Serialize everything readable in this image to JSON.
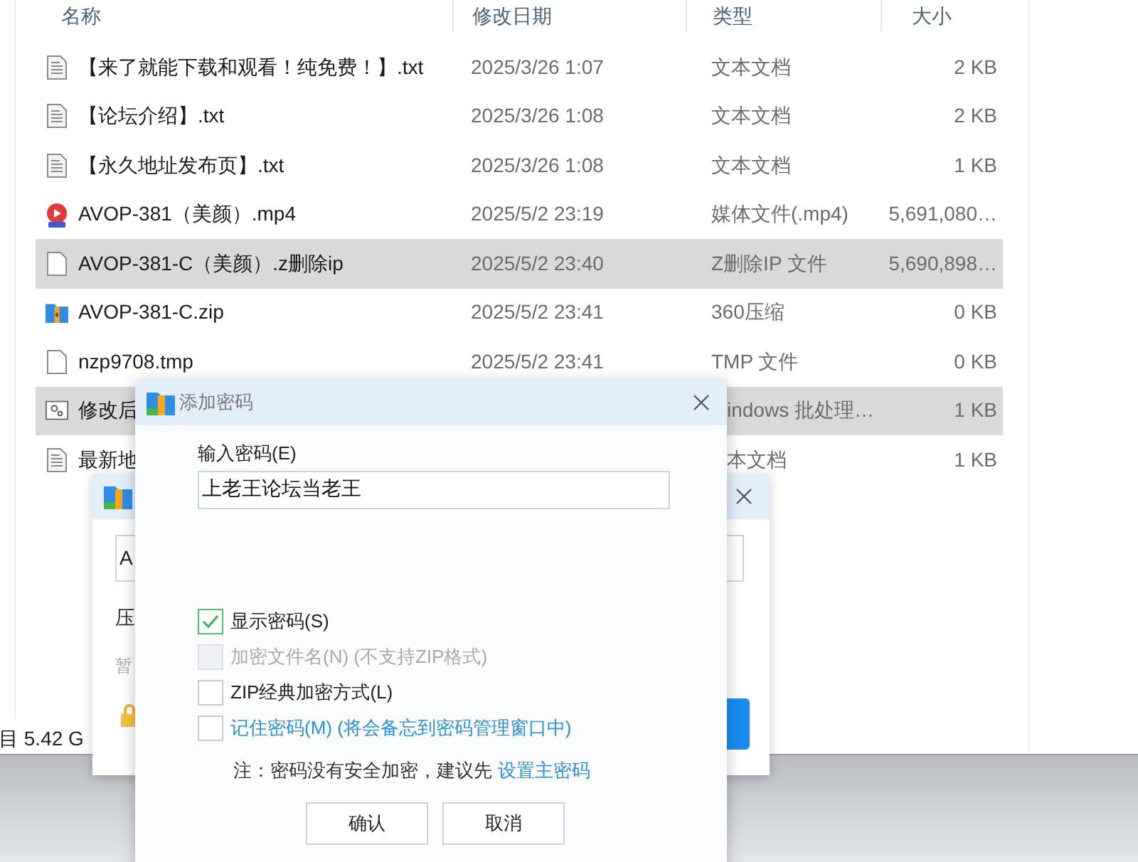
{
  "file_list": {
    "columns": [
      "名称",
      "修改日期",
      "类型",
      "大小"
    ],
    "rows": [
      {
        "kind": "text-document",
        "name": "【来了就能下载和观看！纯免费！】.txt",
        "modified": "2025/3/26 1:07",
        "type": "文本文档",
        "size": "2 KB",
        "selected": false
      },
      {
        "kind": "text-document",
        "name": "【论坛介绍】.txt",
        "modified": "2025/3/26 1:08",
        "type": "文本文档",
        "size": "2 KB",
        "selected": false
      },
      {
        "kind": "text-document",
        "name": "【永久地址发布页】.txt",
        "modified": "2025/3/26 1:08",
        "type": "文本文档",
        "size": "1 KB",
        "selected": false
      },
      {
        "kind": "video",
        "name": "AVOP-381（美颜）.mp4",
        "modified": "2025/5/2 23:19",
        "type": "媒体文件(.mp4)",
        "size": "5,691,080…",
        "selected": false
      },
      {
        "kind": "blank",
        "name": "AVOP-381-C（美颜）.z删除ip",
        "modified": "2025/5/2 23:40",
        "type": "Z删除IP 文件",
        "size": "5,690,898…",
        "selected": true
      },
      {
        "kind": "archive",
        "name": "AVOP-381-C.zip",
        "modified": "2025/5/2 23:41",
        "type": "360压缩",
        "size": "0 KB",
        "selected": false
      },
      {
        "kind": "blank",
        "name": "nzp9708.tmp",
        "modified": "2025/5/2 23:41",
        "type": "TMP 文件",
        "size": "0 KB",
        "selected": false
      },
      {
        "kind": "script",
        "name": "修改后",
        "type": "indows 批处理…",
        "size": "1 KB",
        "selected": true,
        "covered": true
      },
      {
        "kind": "text-document",
        "name": "最新地",
        "type": "本文档",
        "size": "1 KB",
        "selected": false,
        "covered": true
      }
    ]
  },
  "status_bar": {
    "text": "目 5.42 G"
  },
  "background_dialog": {
    "field_value": "A",
    "labels": [
      "压",
      "暂"
    ]
  },
  "password_dialog": {
    "title": "添加密码",
    "field_label": "输入密码(E)",
    "password": "上老王论坛当老王",
    "options": [
      {
        "label": "显示密码(S)",
        "checked": true,
        "disabled": false,
        "kind": "plain"
      },
      {
        "label": "加密文件名(N) (不支持ZIP格式)",
        "checked": false,
        "disabled": true,
        "kind": "plain"
      },
      {
        "label": "ZIP经典加密方式(L)",
        "checked": false,
        "disabled": false,
        "kind": "plain"
      },
      {
        "label": "记住密码(M) (将会备忘到密码管理窗口中)",
        "checked": false,
        "disabled": false,
        "kind": "link"
      }
    ],
    "note": "注：密码没有安全加密，建议先",
    "note_link": "设置主密码",
    "buttons": [
      "确认",
      "取消"
    ]
  }
}
